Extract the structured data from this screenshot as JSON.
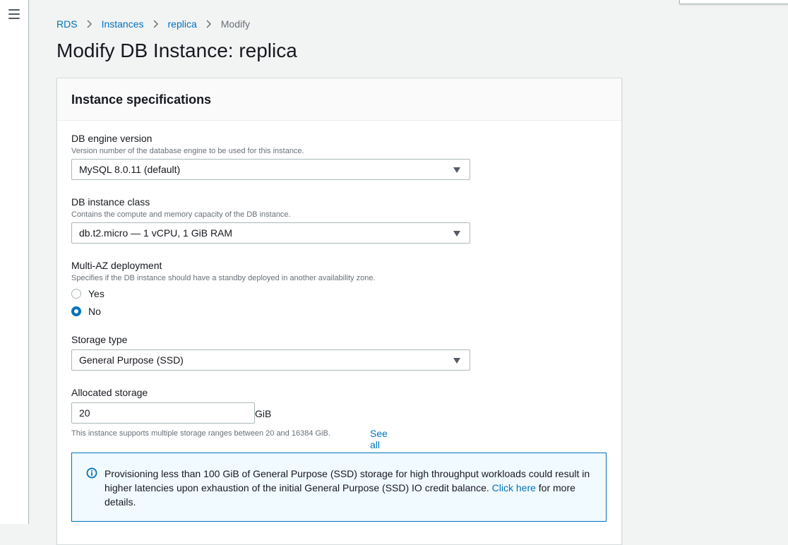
{
  "nav": {
    "menu_icon": "hamburger-menu-icon"
  },
  "breadcrumb": {
    "items": [
      "RDS",
      "Instances",
      "replica"
    ],
    "current": "Modify"
  },
  "page_title": "Modify DB Instance: replica",
  "panel": {
    "title": "Instance specifications",
    "engine_version": {
      "label": "DB engine version",
      "description": "Version number of the database engine to be used for this instance.",
      "value": "MySQL 8.0.11 (default)"
    },
    "instance_class": {
      "label": "DB instance class",
      "description": "Contains the compute and memory capacity of the DB instance.",
      "value": "db.t2.micro — 1 vCPU, 1 GiB RAM"
    },
    "multi_az": {
      "label": "Multi-AZ deployment",
      "description": "Specifies if the DB instance should have a standby deployed in another availability zone.",
      "options": [
        "Yes",
        "No"
      ],
      "selected": "No"
    },
    "storage_type": {
      "label": "Storage type",
      "value": "General Purpose (SSD)"
    },
    "allocated_storage": {
      "label": "Allocated storage",
      "value": "20",
      "unit": "GiB",
      "constraint": "This instance supports multiple storage ranges between 20 and 16384 GiB.",
      "see_all": "See all"
    },
    "info": {
      "text_before": "Provisioning less than 100 GiB of General Purpose (SSD) storage for high throughput workloads could result in higher latencies upon exhaustion of the initial General Purpose (SSD) IO credit balance. ",
      "link": "Click here",
      "text_after": " for more details."
    }
  },
  "colors": {
    "link": "#0073bb",
    "background": "#f2f3f3",
    "info_bg": "#f1faff"
  }
}
